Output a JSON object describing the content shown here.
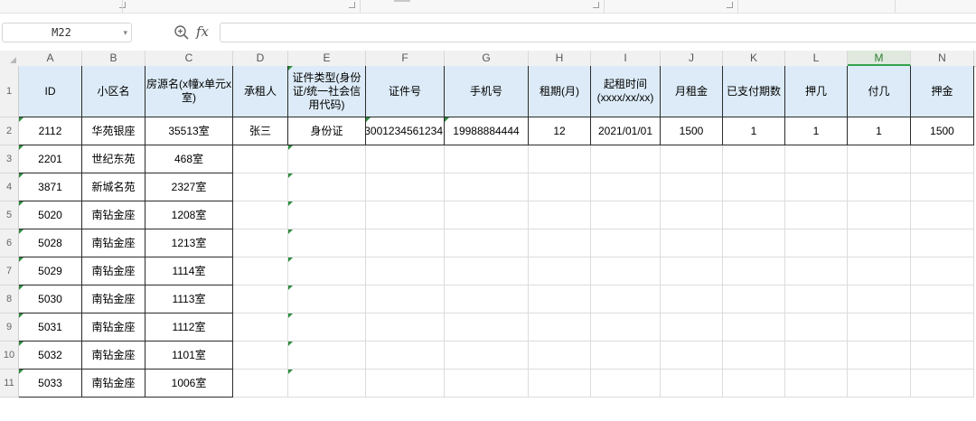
{
  "formula_bar": {
    "cell_reference": "M22",
    "fx_label": "fx",
    "formula_value": ""
  },
  "sheet": {
    "active_column": "M",
    "columns": [
      "A",
      "B",
      "C",
      "D",
      "E",
      "F",
      "G",
      "H",
      "I",
      "J",
      "K",
      "L",
      "M",
      "N"
    ],
    "rows": [
      "1",
      "2",
      "3",
      "4",
      "5",
      "6",
      "7",
      "8",
      "9",
      "10",
      "11"
    ],
    "table_headers": [
      "ID",
      "小区名",
      "房源名(x幢x单元x室)",
      "承租人",
      "证件类型(身份证/统一社会信用代码)",
      "证件号",
      "手机号",
      "租期(月)",
      "起租时间(xxxx/xx/xx)",
      "月租金",
      "已支付期数",
      "押几",
      "付几",
      "押金"
    ],
    "table_rows": [
      [
        "2112",
        "华苑银座",
        "35513室",
        "张三",
        "身份证",
        "3001234561234",
        "19988884444",
        "12",
        "2021/01/01",
        "1500",
        "1",
        "1",
        "1",
        "1500"
      ],
      [
        "2201",
        "世纪东苑",
        "468室",
        "",
        "",
        "",
        "",
        "",
        "",
        "",
        "",
        "",
        "",
        ""
      ],
      [
        "3871",
        "新城名苑",
        "2327室",
        "",
        "",
        "",
        "",
        "",
        "",
        "",
        "",
        "",
        "",
        ""
      ],
      [
        "5020",
        "南钻金座",
        "1208室",
        "",
        "",
        "",
        "",
        "",
        "",
        "",
        "",
        "",
        "",
        ""
      ],
      [
        "5028",
        "南钻金座",
        "1213室",
        "",
        "",
        "",
        "",
        "",
        "",
        "",
        "",
        "",
        "",
        ""
      ],
      [
        "5029",
        "南钻金座",
        "1114室",
        "",
        "",
        "",
        "",
        "",
        "",
        "",
        "",
        "",
        "",
        ""
      ],
      [
        "5030",
        "南钻金座",
        "1113室",
        "",
        "",
        "",
        "",
        "",
        "",
        "",
        "",
        "",
        "",
        ""
      ],
      [
        "5031",
        "南钻金座",
        "1112室",
        "",
        "",
        "",
        "",
        "",
        "",
        "",
        "",
        "",
        "",
        ""
      ],
      [
        "5032",
        "南钻金座",
        "1101室",
        "",
        "",
        "",
        "",
        "",
        "",
        "",
        "",
        "",
        "",
        ""
      ],
      [
        "5033",
        "南钻金座",
        "1006室",
        "",
        "",
        "",
        "",
        "",
        "",
        "",
        "",
        "",
        "",
        ""
      ]
    ]
  },
  "colors": {
    "header_fill": "#dcebf7",
    "active_column_accent": "#33a34a",
    "comment_flag": "#2e8b3e"
  },
  "icons": {
    "zoom": "zoom-in-icon",
    "dropdown": "chevron-down-icon"
  }
}
